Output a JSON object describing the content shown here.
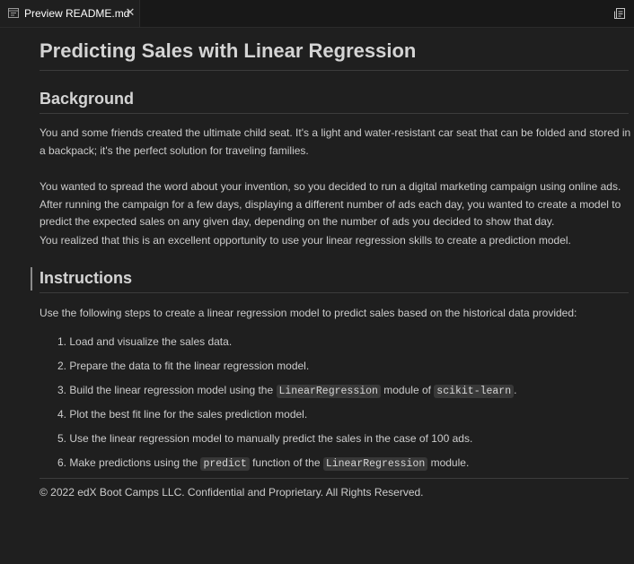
{
  "tab": {
    "label": "Preview README.md",
    "close_glyph": "✕",
    "icon": "preview-icon"
  },
  "toolbar": {
    "icon": "open-source-icon"
  },
  "doc": {
    "title": "Predicting Sales with Linear Regression",
    "background_heading": "Background",
    "bg_p1": "You and some friends created the ultimate child seat. It's a light and water-resistant car seat that can be folded and stored in a backpack; it's the perfect solution for traveling families.",
    "bg_p2": "You wanted to spread the word about your invention, so you decided to run a digital marketing campaign using online ads. After running the campaign for a few days, displaying a different number of ads each day, you wanted to create a model to predict the expected sales on any given day, depending on the number of ads you decided to show that day.",
    "bg_p3": "You realized that this is an excellent opportunity to use your linear regression skills to create a prediction model.",
    "instructions_heading": "Instructions",
    "instructions_intro": "Use the following steps to create a linear regression model to predict sales based on the historical data provided:",
    "steps": [
      {
        "num": "1.",
        "text": "Load and visualize the sales data."
      },
      {
        "num": "2.",
        "text": "Prepare the data to fit the linear regression model."
      },
      {
        "num": "3.",
        "pre": "Build the linear regression model using the ",
        "code1": "LinearRegression",
        "mid": " module of ",
        "code2": "scikit-learn",
        "post": "."
      },
      {
        "num": "4.",
        "text": "Plot the best fit line for the sales prediction model."
      },
      {
        "num": "5.",
        "text": "Use the linear regression model to manually predict the sales in the case of 100 ads."
      },
      {
        "num": "6.",
        "pre": "Make predictions using the ",
        "code1": "predict",
        "mid": " function of the ",
        "code2": "LinearRegression",
        "post": " module."
      }
    ],
    "footer": "© 2022 edX Boot Camps LLC. Confidential and Proprietary. All Rights Reserved."
  }
}
